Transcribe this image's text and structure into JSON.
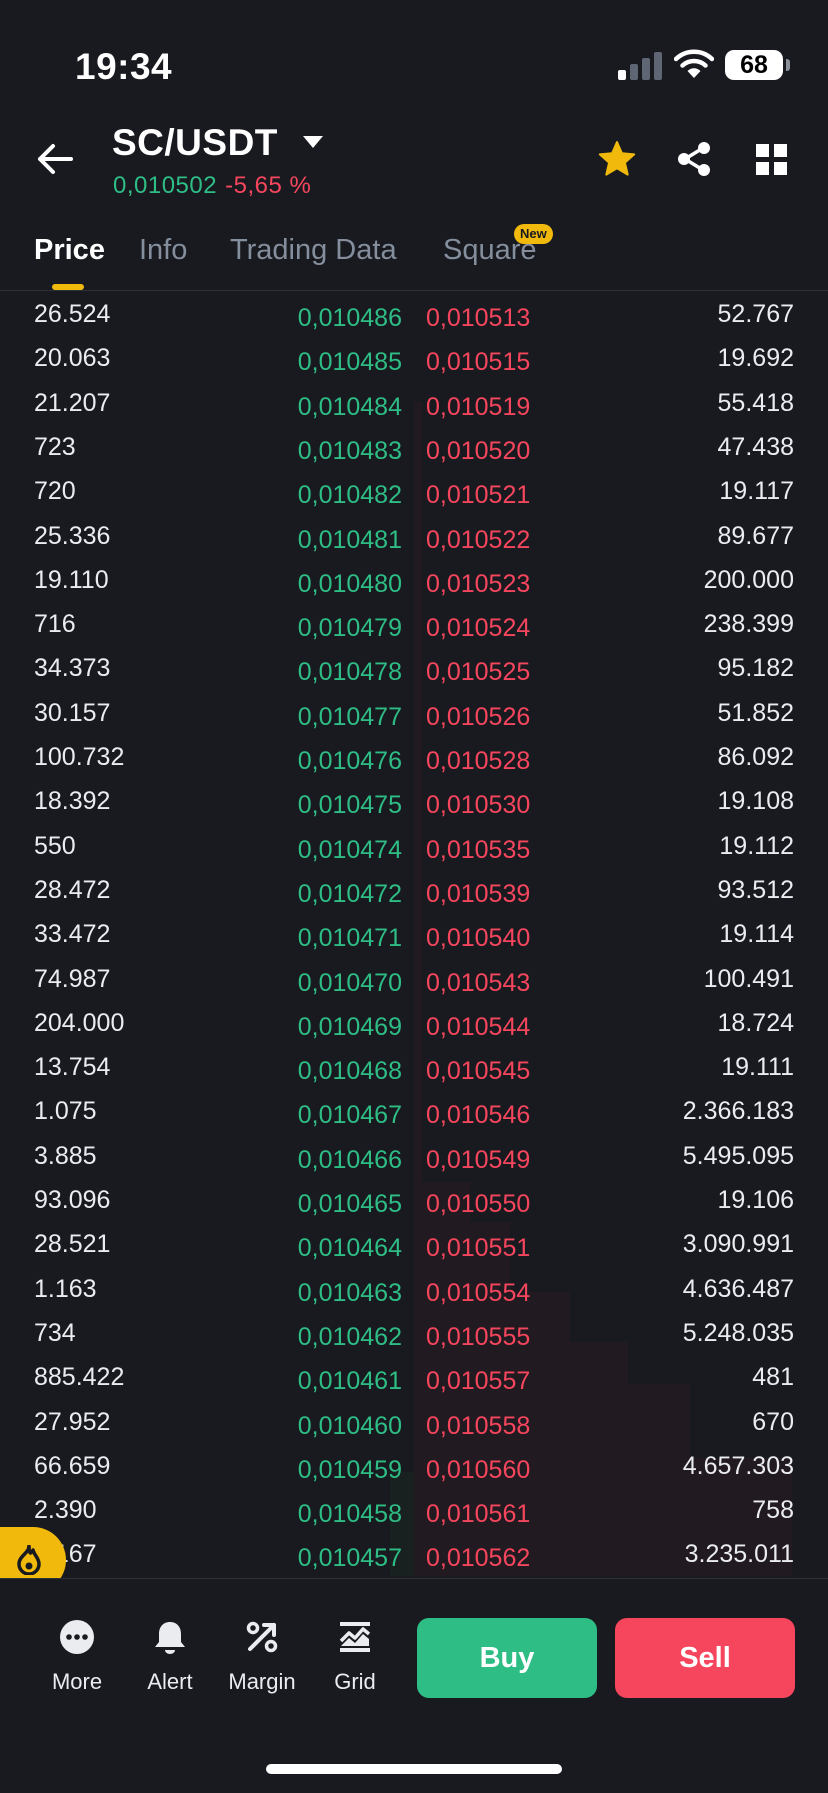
{
  "status_bar": {
    "time": "19:34",
    "battery": "68"
  },
  "header": {
    "pair": "SC/USDT",
    "last_price": "0,010502",
    "change": "-5,65 %",
    "icons": [
      "back-arrow-icon",
      "caret-down-icon",
      "star-icon",
      "share-icon",
      "grid-icon"
    ]
  },
  "tabs": [
    {
      "label": "Price",
      "active": true
    },
    {
      "label": "Info"
    },
    {
      "label": "Trading Data"
    },
    {
      "label": "Square",
      "badge": "New"
    }
  ],
  "order_book": [
    {
      "bid_qty": "26.524",
      "bid_price": "0,010486",
      "ask_price": "0,010513",
      "ask_qty": "52.767"
    },
    {
      "bid_qty": "20.063",
      "bid_price": "0,010485",
      "ask_price": "0,010515",
      "ask_qty": "19.692"
    },
    {
      "bid_qty": "21.207",
      "bid_price": "0,010484",
      "ask_price": "0,010519",
      "ask_qty": "55.418"
    },
    {
      "bid_qty": "723",
      "bid_price": "0,010483",
      "ask_price": "0,010520",
      "ask_qty": "47.438"
    },
    {
      "bid_qty": "720",
      "bid_price": "0,010482",
      "ask_price": "0,010521",
      "ask_qty": "19.117"
    },
    {
      "bid_qty": "25.336",
      "bid_price": "0,010481",
      "ask_price": "0,010522",
      "ask_qty": "89.677"
    },
    {
      "bid_qty": "19.110",
      "bid_price": "0,010480",
      "ask_price": "0,010523",
      "ask_qty": "200.000"
    },
    {
      "bid_qty": "716",
      "bid_price": "0,010479",
      "ask_price": "0,010524",
      "ask_qty": "238.399"
    },
    {
      "bid_qty": "34.373",
      "bid_price": "0,010478",
      "ask_price": "0,010525",
      "ask_qty": "95.182"
    },
    {
      "bid_qty": "30.157",
      "bid_price": "0,010477",
      "ask_price": "0,010526",
      "ask_qty": "51.852"
    },
    {
      "bid_qty": "100.732",
      "bid_price": "0,010476",
      "ask_price": "0,010528",
      "ask_qty": "86.092"
    },
    {
      "bid_qty": "18.392",
      "bid_price": "0,010475",
      "ask_price": "0,010530",
      "ask_qty": "19.108"
    },
    {
      "bid_qty": "550",
      "bid_price": "0,010474",
      "ask_price": "0,010535",
      "ask_qty": "19.112"
    },
    {
      "bid_qty": "28.472",
      "bid_price": "0,010472",
      "ask_price": "0,010539",
      "ask_qty": "93.512"
    },
    {
      "bid_qty": "33.472",
      "bid_price": "0,010471",
      "ask_price": "0,010540",
      "ask_qty": "19.114"
    },
    {
      "bid_qty": "74.987",
      "bid_price": "0,010470",
      "ask_price": "0,010543",
      "ask_qty": "100.491"
    },
    {
      "bid_qty": "204.000",
      "bid_price": "0,010469",
      "ask_price": "0,010544",
      "ask_qty": "18.724"
    },
    {
      "bid_qty": "13.754",
      "bid_price": "0,010468",
      "ask_price": "0,010545",
      "ask_qty": "19.111"
    },
    {
      "bid_qty": "1.075",
      "bid_price": "0,010467",
      "ask_price": "0,010546",
      "ask_qty": "2.366.183"
    },
    {
      "bid_qty": "3.885",
      "bid_price": "0,010466",
      "ask_price": "0,010549",
      "ask_qty": "5.495.095"
    },
    {
      "bid_qty": "93.096",
      "bid_price": "0,010465",
      "ask_price": "0,010550",
      "ask_qty": "19.106"
    },
    {
      "bid_qty": "28.521",
      "bid_price": "0,010464",
      "ask_price": "0,010551",
      "ask_qty": "3.090.991"
    },
    {
      "bid_qty": "1.163",
      "bid_price": "0,010463",
      "ask_price": "0,010554",
      "ask_qty": "4.636.487"
    },
    {
      "bid_qty": "734",
      "bid_price": "0,010462",
      "ask_price": "0,010555",
      "ask_qty": "5.248.035"
    },
    {
      "bid_qty": "885.422",
      "bid_price": "0,010461",
      "ask_price": "0,010557",
      "ask_qty": "481"
    },
    {
      "bid_qty": "27.952",
      "bid_price": "0,010460",
      "ask_price": "0,010558",
      "ask_qty": "670"
    },
    {
      "bid_qty": "66.659",
      "bid_price": "0,010459",
      "ask_price": "0,010560",
      "ask_qty": "4.657.303"
    },
    {
      "bid_qty": "2.390",
      "bid_price": "0,010458",
      "ask_price": "0,010561",
      "ask_qty": "758"
    },
    {
      "bid_qty": "9.167",
      "bid_price": "0,010457",
      "ask_price": "0,010562",
      "ask_qty": "3.235.011"
    }
  ],
  "bottom_bar": {
    "nav": [
      {
        "label": "More",
        "icon": "more-dots-icon"
      },
      {
        "label": "Alert",
        "icon": "bell-icon"
      },
      {
        "label": "Margin",
        "icon": "percent-icon"
      },
      {
        "label": "Grid",
        "icon": "grid-bot-icon"
      }
    ],
    "buy_label": "Buy",
    "sell_label": "Sell"
  },
  "colors": {
    "background": "#181A20",
    "bid": "#2EBD85",
    "ask": "#F6465D",
    "accent": "#F0B90B"
  }
}
